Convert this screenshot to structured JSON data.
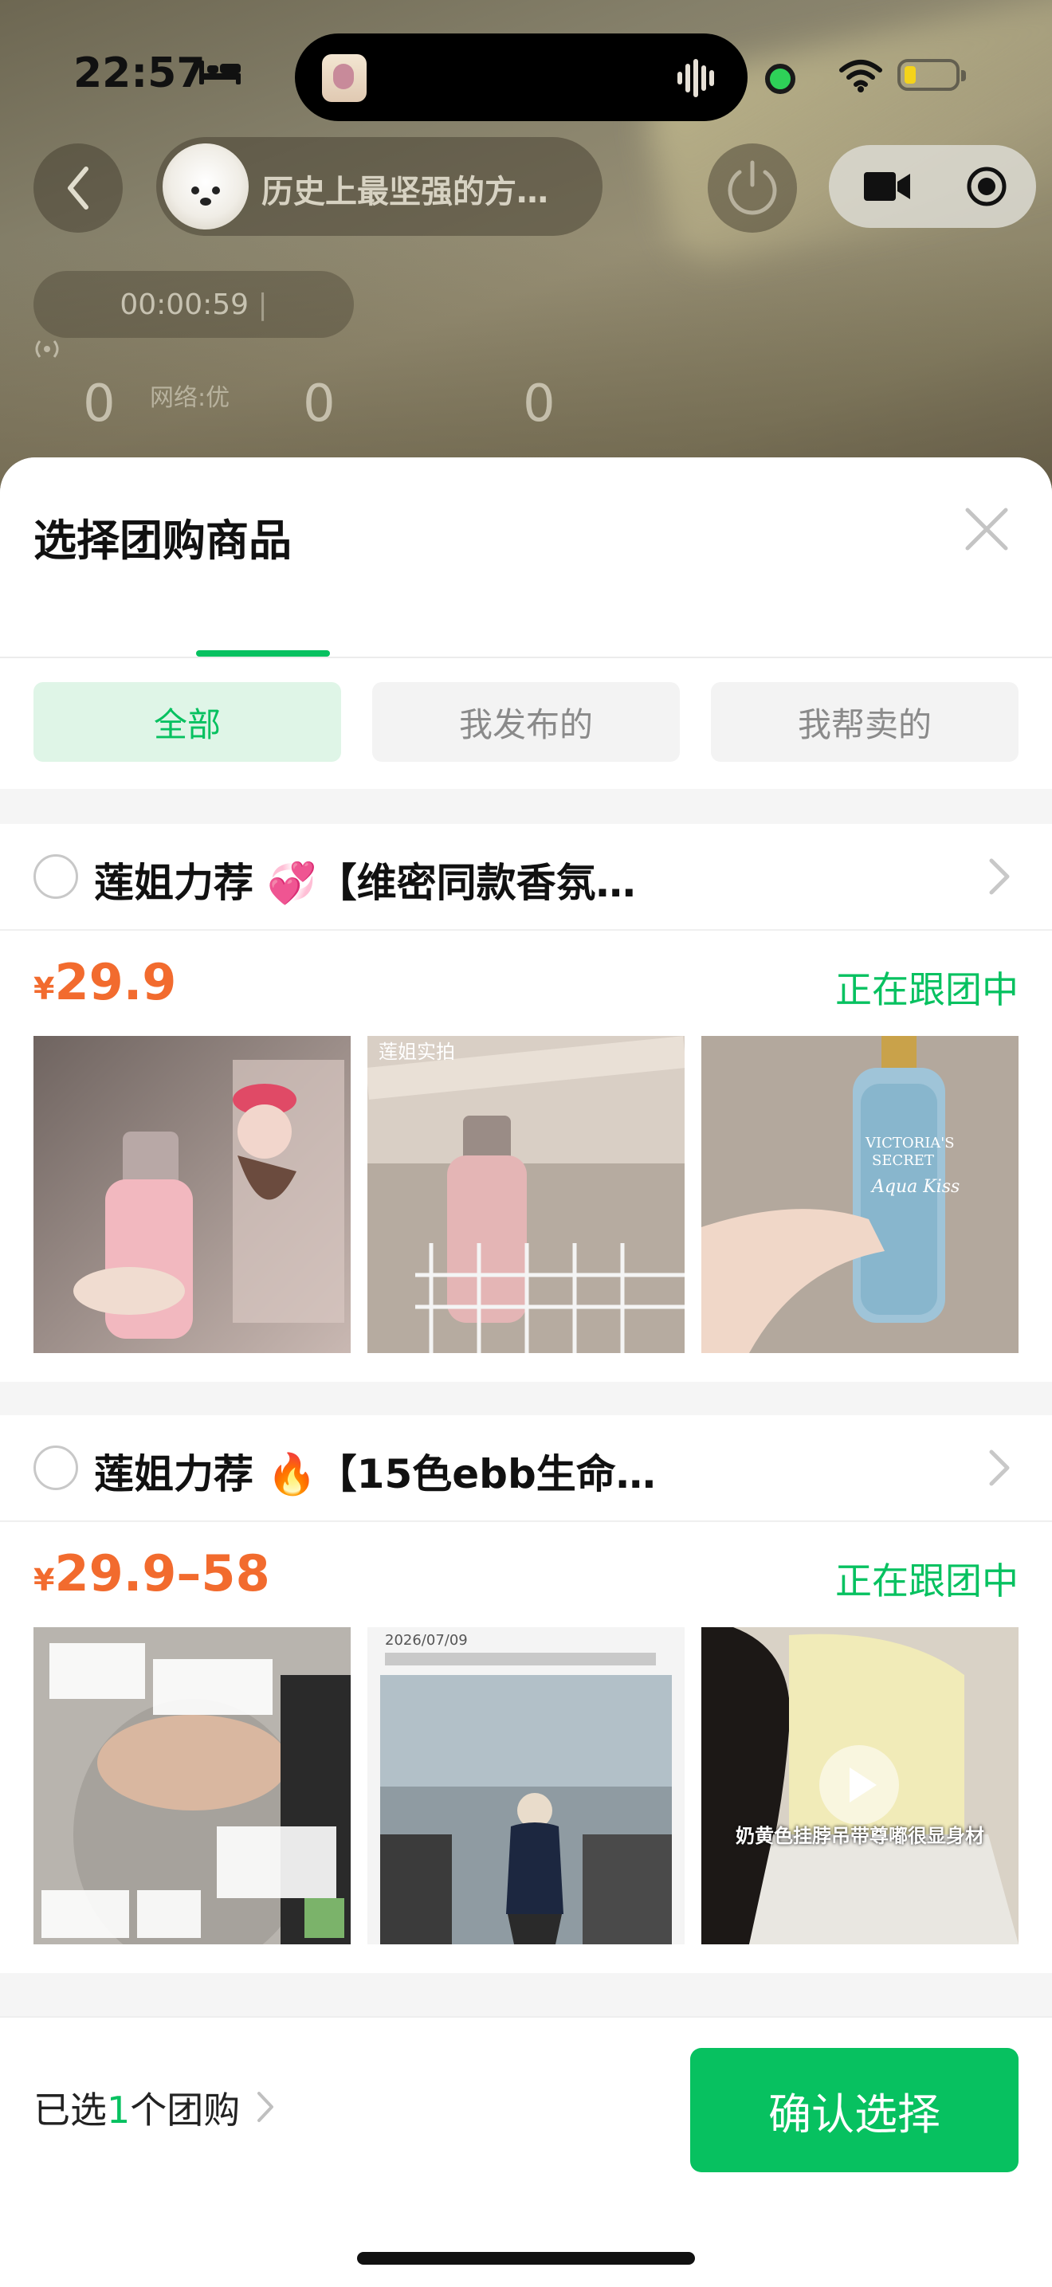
{
  "status_bar": {
    "time": "22:57"
  },
  "live": {
    "room_title": "历史上最坚强的方…",
    "timer": "00:00:59",
    "network": "网络:优",
    "stats": [
      "0",
      "0",
      "0"
    ]
  },
  "sheet": {
    "title": "选择团购商品",
    "filters": [
      "全部",
      "我发布的",
      "我帮卖的"
    ],
    "products": [
      {
        "title": "莲姐力荐 💞【维密同款香氛…",
        "currency": "¥",
        "price": "29.9",
        "status": "正在跟团中",
        "image_captions": [
          "",
          "莲姐实拍",
          "VICTORIA'S SECRET Aqua Kiss"
        ]
      },
      {
        "title": "莲姐力荐 🔥【15色ebb生命…",
        "currency": "¥",
        "price": "29.9–58",
        "status": "正在跟团中",
        "image_captions": [
          "",
          "2026/07/09",
          "奶黄色挂脖吊带尊嘟很显身材"
        ]
      }
    ],
    "footer": {
      "selected_prefix": "已选",
      "selected_count": "1",
      "selected_suffix": "个团购",
      "confirm_label": "确认选择"
    }
  },
  "colors": {
    "accent": "#07c160",
    "price": "#f26b2e"
  }
}
